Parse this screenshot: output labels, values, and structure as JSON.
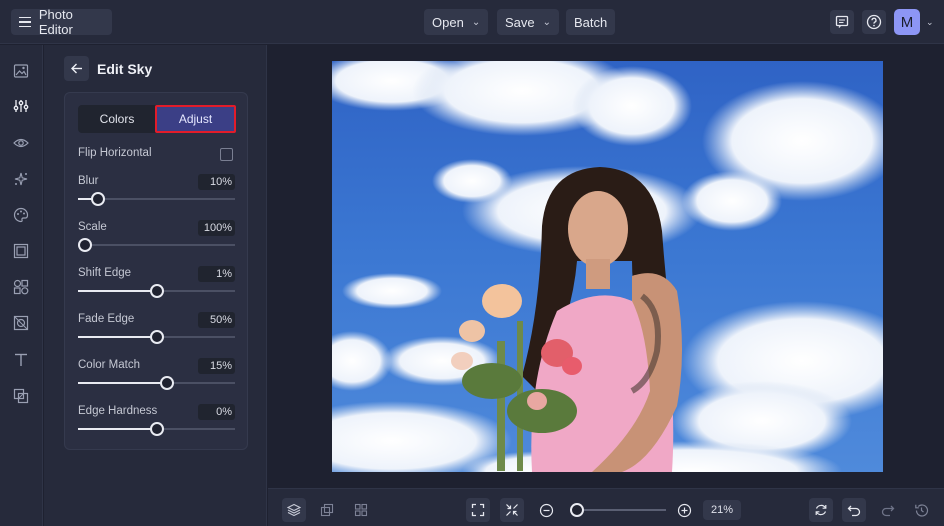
{
  "app": {
    "title": "Photo Editor"
  },
  "toolbar": {
    "open_label": "Open",
    "save_label": "Save",
    "batch_label": "Batch",
    "avatar_initial": "M"
  },
  "panel": {
    "title": "Edit Sky",
    "tabs": {
      "colors": "Colors",
      "adjust": "Adjust",
      "active": "Adjust"
    },
    "flip_label": "Flip Horizontal",
    "flip_checked": false,
    "sliders": [
      {
        "label": "Blur",
        "value_text": "10%",
        "fraction": 0.13
      },
      {
        "label": "Scale",
        "value_text": "100%",
        "fraction": 0.0
      },
      {
        "label": "Shift Edge",
        "value_text": "1%",
        "fraction": 0.5
      },
      {
        "label": "Fade Edge",
        "value_text": "50%",
        "fraction": 0.5
      },
      {
        "label": "Color Match",
        "value_text": "15%",
        "fraction": 0.57
      },
      {
        "label": "Edge Hardness",
        "value_text": "0%",
        "fraction": 0.5
      }
    ]
  },
  "zoom": {
    "value_text": "21%",
    "fraction": 0.0
  },
  "colors": {
    "accent": "#8d96f5",
    "active_tab": "#3b3f86",
    "highlight": "#e21c2a",
    "sky": "#3b77d2"
  }
}
